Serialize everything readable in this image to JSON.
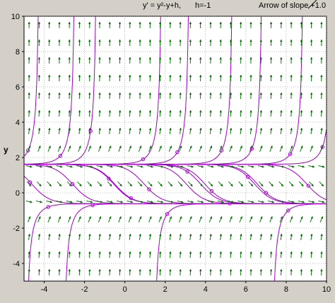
{
  "window": {
    "equation": "y' = y²-y+h,",
    "parameter": "h=-1",
    "slope_legend": "Arrow of slope +1.0"
  },
  "chart_data": {
    "type": "slope-field",
    "title": "y' = y²-y+h,   h=-1",
    "ylabel": "y",
    "xlabel": "",
    "xlim": [
      -5,
      10
    ],
    "ylim": [
      -5,
      10
    ],
    "x_ticks": [
      -4,
      -2,
      0,
      2,
      4,
      6,
      8,
      10
    ],
    "x_tick_labels": [
      "-4",
      "-2",
      "0",
      "2",
      "4",
      "6",
      "8",
      "10"
    ],
    "y_ticks": [
      -4,
      -2,
      0,
      2,
      4,
      6,
      8,
      10
    ],
    "y_tick_labels": [
      "-4",
      "-2",
      "0",
      "2",
      "4",
      "6",
      "8",
      "10"
    ],
    "grid": true,
    "parameter_h": -1,
    "equilibria": [
      1.618,
      -0.618
    ],
    "arrow_grid": {
      "x": [
        -4.75,
        -4.25,
        -3.75,
        -3.25,
        -2.75,
        -2.25,
        -1.75,
        -1.25,
        -0.75,
        -0.25,
        0.25,
        0.75,
        1.25,
        1.75,
        2.25,
        2.75,
        3.25,
        3.75,
        4.25,
        4.75,
        5.25,
        5.75,
        6.25,
        6.75,
        7.25,
        7.75,
        8.25,
        8.75,
        9.25,
        9.75
      ],
      "y": [
        -4.5,
        -3.5,
        -2.5,
        -1.5,
        -0.5,
        0.5,
        1.5,
        2.5,
        3.5,
        4.5,
        5.5,
        6.5,
        7.5,
        8.5,
        9.5
      ]
    },
    "solution_start_points": [
      {
        "x": -4.8,
        "y": 2.4
      },
      {
        "x": -3.2,
        "y": 2.1
      },
      {
        "x": -1.7,
        "y": 3.5
      },
      {
        "x": 0.9,
        "y": 1.9
      },
      {
        "x": 2.6,
        "y": 2.3
      },
      {
        "x": 4.8,
        "y": 2.4
      },
      {
        "x": 6.3,
        "y": 2.5
      },
      {
        "x": 8.2,
        "y": 2.2
      },
      {
        "x": 9.8,
        "y": 2.6
      },
      {
        "x": -4.7,
        "y": 0.6
      },
      {
        "x": -3.8,
        "y": -0.8
      },
      {
        "x": -2.6,
        "y": 0.5
      },
      {
        "x": -1.6,
        "y": -0.7
      },
      {
        "x": -0.8,
        "y": 0.8
      },
      {
        "x": 0.3,
        "y": -0.3
      },
      {
        "x": 1.2,
        "y": 0.2
      },
      {
        "x": 2.1,
        "y": -1.2
      },
      {
        "x": 3.1,
        "y": 1.2
      },
      {
        "x": 4.3,
        "y": 0.1
      },
      {
        "x": 5.2,
        "y": -0.6
      },
      {
        "x": 6.1,
        "y": 0.9
      },
      {
        "x": 7.0,
        "y": 0.0
      },
      {
        "x": 8.1,
        "y": -1.0
      },
      {
        "x": 9.1,
        "y": 0.4
      }
    ],
    "colors": {
      "background": "#d4d0c8",
      "plot_background": "#ffffff",
      "grid": "#808080",
      "arrow": "#008000",
      "arrow_head": "#006400",
      "curve": "#a000c8",
      "marker": "#a000c8",
      "axis": "#000000"
    }
  }
}
